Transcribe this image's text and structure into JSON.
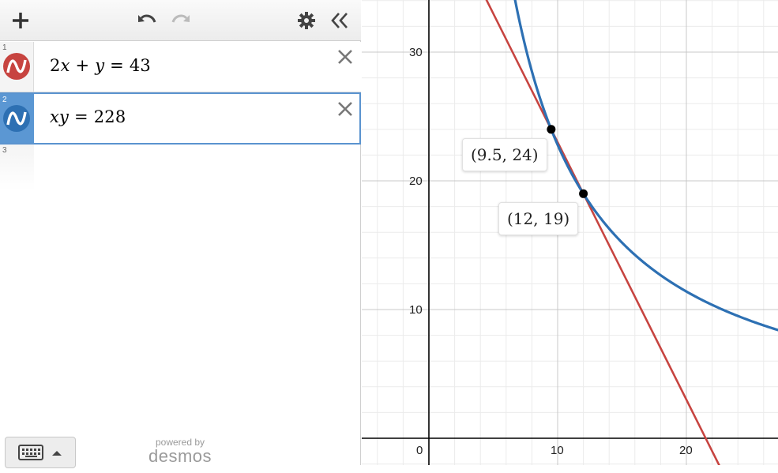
{
  "toolbar": {
    "add_icon": "plus-icon",
    "undo_icon": "undo-icon",
    "redo_icon": "redo-icon",
    "settings_icon": "gear-icon",
    "collapse_icon": "double-chevron-left-icon"
  },
  "expressions": [
    {
      "index": "1",
      "lhs_coef": "2",
      "var1": "x",
      "op": "+",
      "var2": "y",
      "eq": "=",
      "rhs": "43",
      "color": "#c74440"
    },
    {
      "index": "2",
      "var1": "x",
      "var2": "y",
      "eq": "=",
      "rhs": "228",
      "color": "#2d70b3"
    },
    {
      "index": "3"
    }
  ],
  "branding": {
    "powered_by": "powered by",
    "name": "desmos"
  },
  "graph": {
    "x_ticks": [
      "0",
      "10",
      "20"
    ],
    "y_ticks": [
      "10",
      "20",
      "30"
    ],
    "point_labels": [
      "(9.5, 24)",
      "(12, 19)"
    ],
    "points": [
      {
        "x": 9.5,
        "y": 24
      },
      {
        "x": 12,
        "y": 19
      }
    ],
    "colors": {
      "line": "#c74440",
      "curve": "#2d70b3",
      "axis": "#000000",
      "major_grid": "#c8c8c8",
      "minor_grid": "#ebebeb"
    }
  }
}
